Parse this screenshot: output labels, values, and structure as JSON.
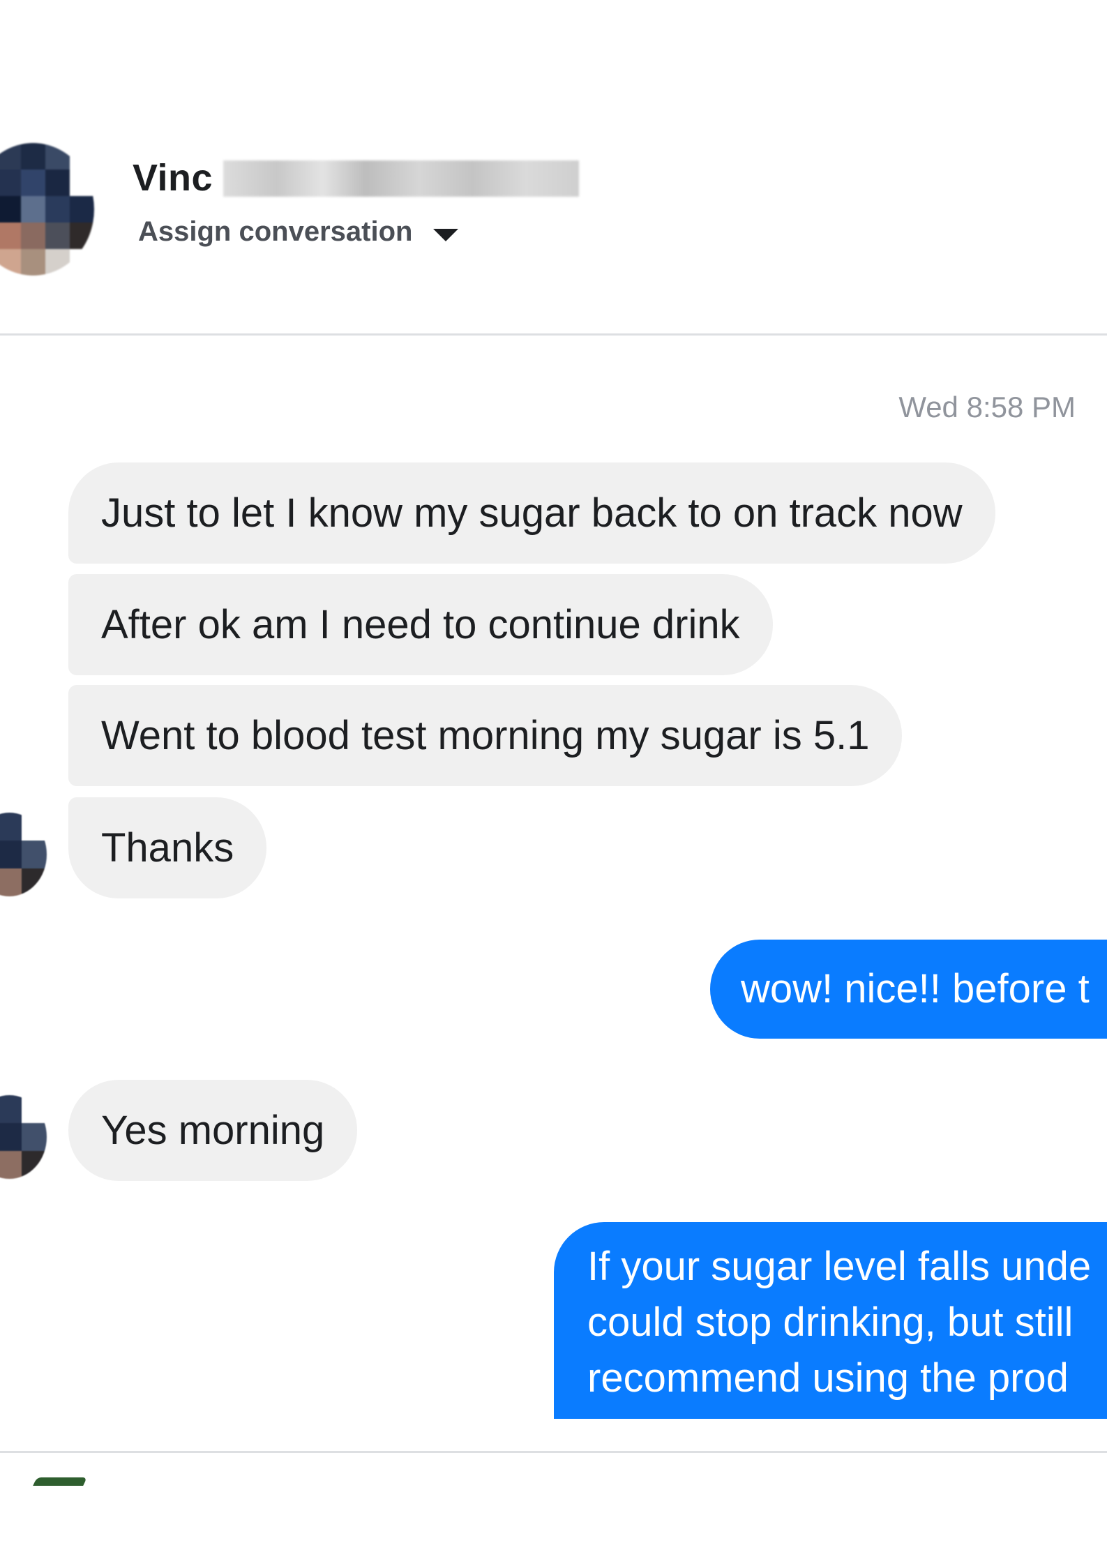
{
  "header": {
    "contact_name_visible": "Vinc",
    "assign_label": "Assign conversation"
  },
  "thread": {
    "timestamp": "Wed 8:58 PM",
    "incoming_group_1": [
      "Just to let I know my sugar back to on track now",
      "After ok am I need to continue drink",
      "Went to blood test morning my sugar is 5.1",
      "Thanks"
    ],
    "outgoing_1": "wow! nice!! before t",
    "incoming_2": "Yes morning",
    "outgoing_2_lines": [
      "If your sugar level falls unde",
      "could stop drinking, but still",
      "recommend using the prod"
    ]
  },
  "colors": {
    "outgoing_bubble": "#0a7cff",
    "incoming_bubble": "#f0f0f0",
    "timestamp": "#90949c"
  },
  "icons": {
    "assign_dropdown": "chevron-down-icon"
  }
}
